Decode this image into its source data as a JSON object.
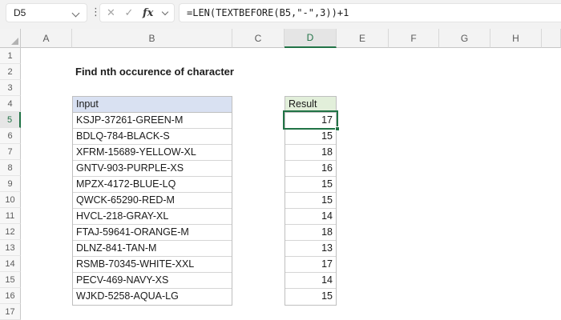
{
  "formula_bar": {
    "name_box": "D5",
    "separator_dots": "⋮",
    "cancel_icon": "✕",
    "enter_icon": "✓",
    "fx_label": "fx",
    "formula": "=LEN(TEXTBEFORE(B5,\"-\",3))+1"
  },
  "grid": {
    "column_headers": [
      "A",
      "B",
      "C",
      "D",
      "E",
      "F",
      "G",
      "H"
    ],
    "selected_column": "D",
    "row_headers": [
      "1",
      "2",
      "3",
      "4",
      "5",
      "6",
      "7",
      "8",
      "9",
      "10",
      "11",
      "12",
      "13",
      "14",
      "15",
      "16",
      "17"
    ],
    "selected_row": "5",
    "active_cell": "D5"
  },
  "sheet": {
    "title": "Find nth occurence of character",
    "input_header": "Input",
    "result_header": "Result",
    "rows": [
      {
        "input": "KSJP-37261-GREEN-M",
        "result": 17
      },
      {
        "input": "BDLQ-784-BLACK-S",
        "result": 15
      },
      {
        "input": "XFRM-15689-YELLOW-XL",
        "result": 18
      },
      {
        "input": "GNTV-903-PURPLE-XS",
        "result": 16
      },
      {
        "input": "MPZX-4172-BLUE-LQ",
        "result": 15
      },
      {
        "input": "QWCK-65290-RED-M",
        "result": 15
      },
      {
        "input": "HVCL-218-GRAY-XL",
        "result": 14
      },
      {
        "input": "FTAJ-59641-ORANGE-M",
        "result": 18
      },
      {
        "input": "DLNZ-841-TAN-M",
        "result": 13
      },
      {
        "input": "RSMB-70345-WHITE-XXL",
        "result": 17
      },
      {
        "input": "PECV-469-NAVY-XS",
        "result": 14
      },
      {
        "input": "WJKD-5258-AQUA-LG",
        "result": 15
      }
    ]
  },
  "colors": {
    "accent_green": "#217346",
    "input_header_fill": "#D9E1F2",
    "result_header_fill": "#E2EFDA"
  }
}
